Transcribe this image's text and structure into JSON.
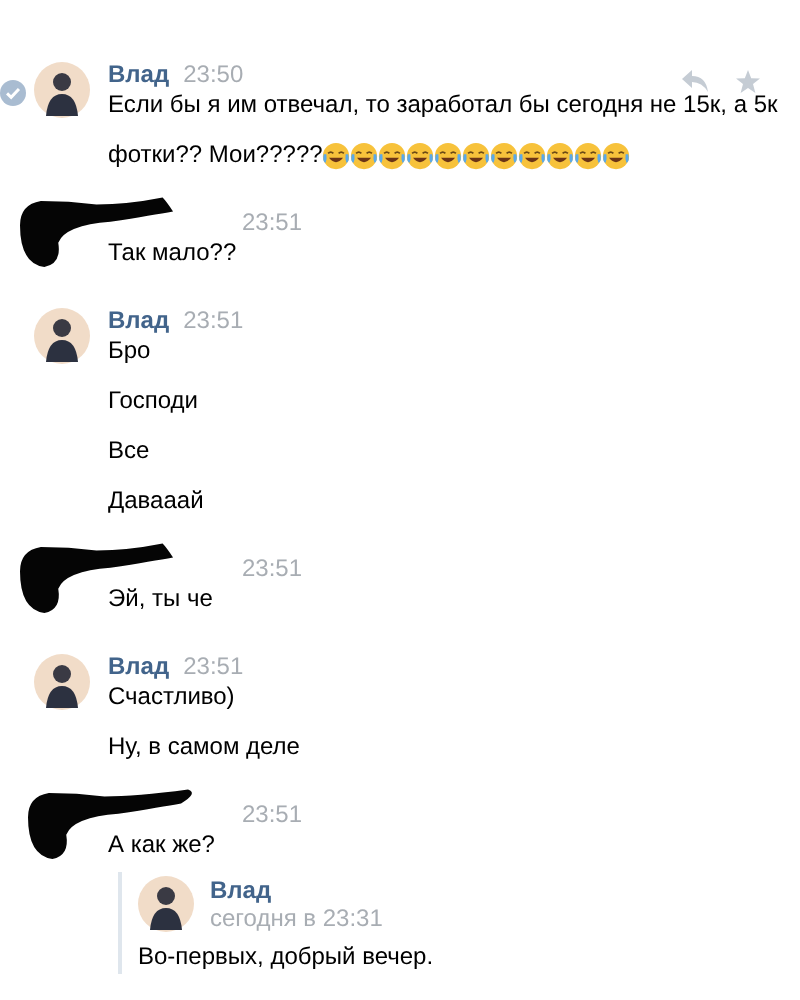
{
  "messages": [
    {
      "author": "Влад",
      "author_hidden": false,
      "time": "23:50",
      "selected": true,
      "lines": [
        {
          "text": "Если бы я им отвечал, то заработал бы сегодня не 15к, а 5к"
        },
        {
          "text": "фотки?? Мои?????",
          "emoji": [
            {
              "kind": "tears-of-joy"
            },
            {
              "kind": "tears-of-joy"
            },
            {
              "kind": "tears-of-joy"
            },
            {
              "kind": "tears-of-joy"
            },
            {
              "kind": "tears-of-joy"
            },
            {
              "kind": "tears-of-joy"
            },
            {
              "kind": "tears-of-joy"
            },
            {
              "kind": "tears-of-joy"
            },
            {
              "kind": "tears-of-joy"
            },
            {
              "kind": "tears-of-joy"
            },
            {
              "kind": "tears-of-joy"
            }
          ]
        }
      ]
    },
    {
      "author_hidden": true,
      "time": "23:51",
      "selected": false,
      "lines": [
        {
          "text": "Так мало??"
        }
      ]
    },
    {
      "author": "Влад",
      "author_hidden": false,
      "time": "23:51",
      "selected": false,
      "lines": [
        {
          "text": "Бро"
        },
        {
          "text": "Господи"
        },
        {
          "text": "Все"
        },
        {
          "text": "Давааай"
        }
      ]
    },
    {
      "author_hidden": true,
      "time": "23:51",
      "selected": false,
      "lines": [
        {
          "text": "Эй, ты че"
        }
      ]
    },
    {
      "author": "Влад",
      "author_hidden": false,
      "time": "23:51",
      "selected": false,
      "lines": [
        {
          "text": "Счастливо)"
        },
        {
          "text": "Ну, в самом деле"
        }
      ]
    },
    {
      "author_hidden": true,
      "time": "23:51",
      "selected": false,
      "lines": [
        {
          "text": "А как же?"
        }
      ],
      "forwarded": {
        "author": "Влад",
        "time": "сегодня в 23:31",
        "text": "Во-первых, добрый вечер."
      }
    }
  ]
}
